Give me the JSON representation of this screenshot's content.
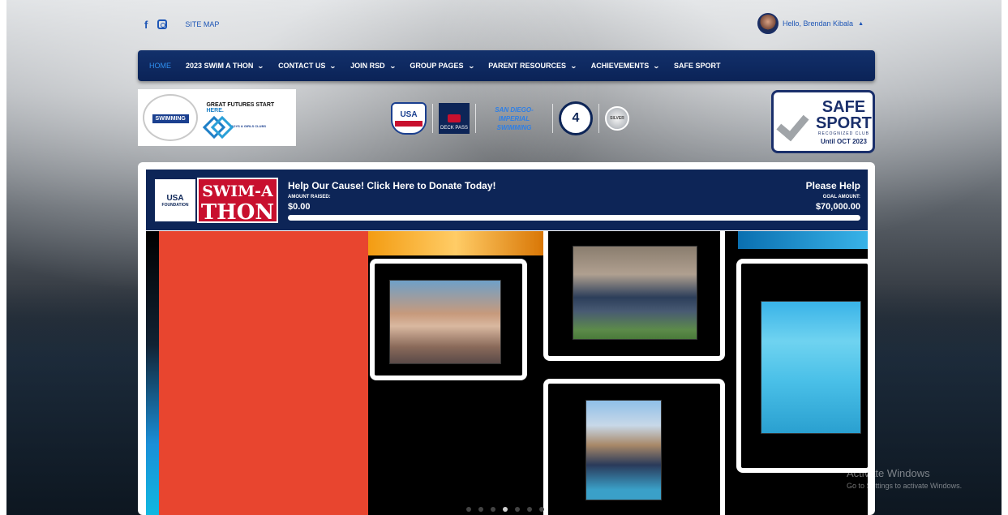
{
  "header": {
    "social": [
      "f"
    ],
    "site_map": "SITE MAP",
    "greeting": "Hello, Brendan Kibala"
  },
  "nav": [
    {
      "label": "HOME",
      "active": true,
      "dropdown": false
    },
    {
      "label": "2023 SWIM A THON",
      "dropdown": true
    },
    {
      "label": "CONTACT US",
      "dropdown": true
    },
    {
      "label": "JOIN RSD",
      "dropdown": true
    },
    {
      "label": "GROUP PAGES",
      "dropdown": true
    },
    {
      "label": "PARENT RESOURCES",
      "dropdown": true
    },
    {
      "label": "ACHIEVEMENTS",
      "dropdown": true
    },
    {
      "label": "SAFE SPORT",
      "dropdown": false
    }
  ],
  "sponsor": {
    "rsd_text": "SWIMMING",
    "tagline_part1": "GREAT FUTURES START",
    "tagline_part2": "HERE.",
    "bgc_name": "BOYS & GIRLS CLUBS"
  },
  "badges": {
    "usa": "USA",
    "deck_pass": "DECK PASS",
    "sdi_line1": "SAN DIEGO-",
    "sdi_line2": "IMPERIAL",
    "sdi_line3": "SWIMMING",
    "level": "4",
    "silver": "SILVER"
  },
  "safesport": {
    "safe": "SAFE",
    "sport": "SPORT",
    "recognized": "RECOGNIZED CLUB",
    "until": "Until OCT 2023"
  },
  "swimathon": {
    "usa_logo": "USA",
    "usa_sub": "FOUNDATION",
    "logo_line1": "SWIM-A",
    "logo_line2": "THON",
    "title": "Help Our Cause! Click Here to Donate Today!",
    "amount_label": "AMOUNT RAISED:",
    "amount_value": "$0.00",
    "please": "Please Help",
    "goal_label": "GOAL AMOUNT:",
    "goal_value": "$70,000.00",
    "progress": 0
  },
  "slider": {
    "dot_count": 7,
    "active_dot": 3
  },
  "windows_watermark": {
    "line1": "Activate Windows",
    "line2": "Go to Settings to activate Windows."
  }
}
